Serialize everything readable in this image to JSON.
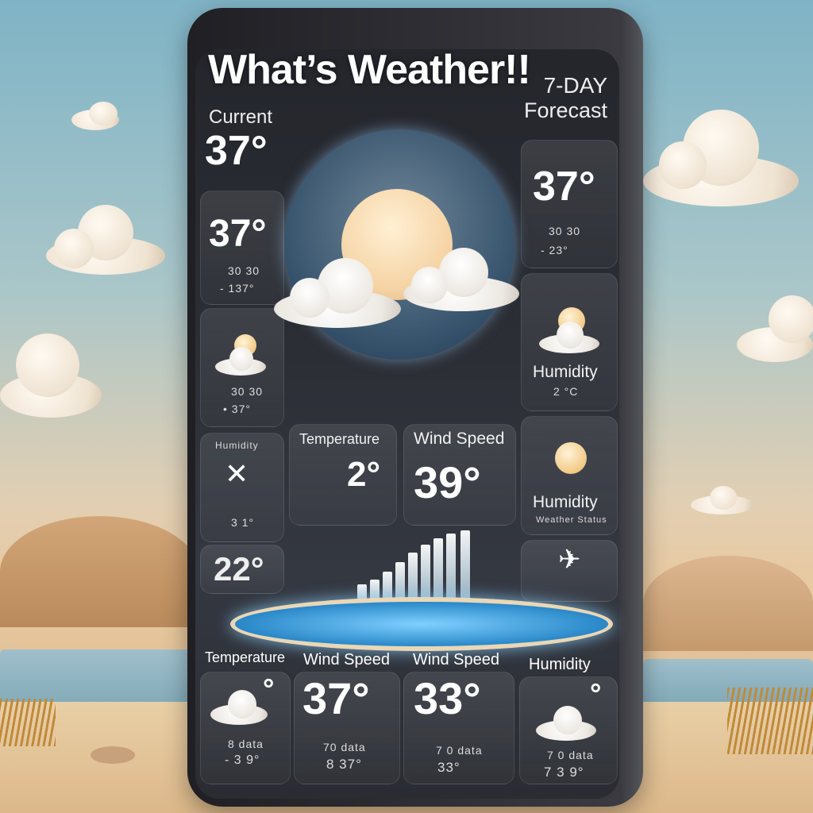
{
  "app": {
    "title": "What’s Weather!!",
    "forecast_line1": "7-DAY",
    "forecast_line2": "Forecast"
  },
  "current": {
    "label": "Current",
    "temp": "37°"
  },
  "left_tiles": [
    {
      "value": "37°",
      "sub1": "30 30",
      "sub2": "- 137°"
    },
    {
      "sub1": "30 30",
      "sub2": "• 37°"
    },
    {
      "sub1": "Humidity",
      "sub2": "3 1°"
    },
    {
      "value": "22°"
    }
  ],
  "right_tiles": [
    {
      "value": "37°",
      "sub1": "30 30",
      "sub2": "- 23°"
    },
    {
      "label": "Humidity",
      "sub": "2 °C"
    },
    {
      "label": "Humidity",
      "sub": "Weather Status"
    }
  ],
  "center_cards": [
    {
      "label": "Temperature",
      "value": "2°"
    },
    {
      "label": "Wind Speed",
      "value": "39°"
    }
  ],
  "bottom_tiles": [
    {
      "label": "Temperature",
      "value": "°",
      "sub1": "8 data",
      "sub2": "- 3 9°"
    },
    {
      "label": "Wind Speed",
      "value": "37°",
      "sub1": "70 data",
      "sub2": "8 37°"
    },
    {
      "label": "Wind Speed",
      "value": "33°",
      "sub1": "7 0 data",
      "sub2": "33°"
    },
    {
      "label": "Humidity",
      "value": "°",
      "sub1": "7 0 data",
      "sub2": "7 3 9°"
    }
  ]
}
